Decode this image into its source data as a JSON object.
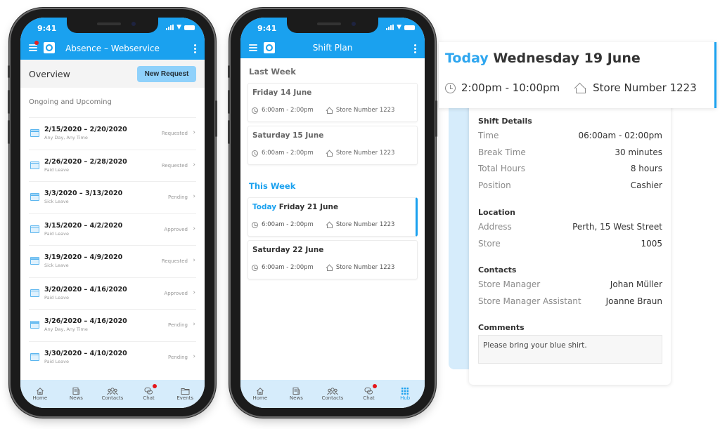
{
  "phone1": {
    "status_time": "9:41",
    "app_title": "Absence – Webservice",
    "overview_title": "Overview",
    "new_request_label": "New Request",
    "section_title": "Ongoing and Upcoming",
    "absences": [
      {
        "dates": "2/15/2020 – 2/20/2020",
        "type": "Any Day, Any Time",
        "status": "Requested"
      },
      {
        "dates": "2/26/2020 – 2/28/2020",
        "type": "Paid Leave",
        "status": "Requested"
      },
      {
        "dates": "3/3/2020 – 3/13/2020",
        "type": "Sick Leave",
        "status": "Pending"
      },
      {
        "dates": "3/15/2020 – 4/2/2020",
        "type": "Paid Leave",
        "status": "Approved"
      },
      {
        "dates": "3/19/2020 – 4/9/2020",
        "type": "Sick Leave",
        "status": "Requested"
      },
      {
        "dates": "3/20/2020 – 4/16/2020",
        "type": "Paid Leave",
        "status": "Approved"
      },
      {
        "dates": "3/26/2020 – 4/16/2020",
        "type": "Any Day, Any Time",
        "status": "Pending"
      },
      {
        "dates": "3/30/2020 – 4/10/2020",
        "type": "Paid Leave",
        "status": "Pending"
      }
    ],
    "tabs": [
      {
        "label": "Home",
        "icon": "home-icon"
      },
      {
        "label": "News",
        "icon": "news-icon"
      },
      {
        "label": "Contacts",
        "icon": "contacts-icon"
      },
      {
        "label": "Chat",
        "icon": "chat-icon",
        "badge": true
      },
      {
        "label": "Events",
        "icon": "folder-icon"
      }
    ]
  },
  "phone2": {
    "status_time": "9:41",
    "app_title": "Shift Plan",
    "last_week_title": "Last Week",
    "this_week_title": "This Week",
    "last_week": [
      {
        "title": "Friday 14 June",
        "time": "6:00am - 2:00pm",
        "store": "Store Number 1223"
      },
      {
        "title": "Saturday 15 June",
        "time": "6:00am - 2:00pm",
        "store": "Store Number 1223"
      }
    ],
    "this_week": [
      {
        "today_label": "Today",
        "title": "Friday 21 June",
        "time": "6:00am - 2:00pm",
        "store": "Store Number 1223",
        "active": true
      },
      {
        "title": "Saturday 22 June",
        "time": "6:00am - 2:00pm",
        "store": "Store Number 1223"
      }
    ],
    "tabs": [
      {
        "label": "Home",
        "icon": "home-icon"
      },
      {
        "label": "News",
        "icon": "news-icon"
      },
      {
        "label": "Contacts",
        "icon": "contacts-icon"
      },
      {
        "label": "Chat",
        "icon": "chat-icon",
        "badge": true
      },
      {
        "label": "Hub",
        "icon": "grid-icon",
        "active": true
      }
    ]
  },
  "detail": {
    "today_label": "Today",
    "title": "Wednesday 19 June",
    "time": "2:00pm - 10:00pm",
    "store": "Store Number 1223",
    "shift_details": {
      "heading": "Shift Details",
      "rows": [
        {
          "label": "Time",
          "value": "06:00am - 02:00pm"
        },
        {
          "label": "Break Time",
          "value": "30 minutes"
        },
        {
          "label": "Total Hours",
          "value": "8 hours"
        },
        {
          "label": "Position",
          "value": "Cashier"
        }
      ]
    },
    "location": {
      "heading": "Location",
      "rows": [
        {
          "label": "Address",
          "value": "Perth, 15 West Street"
        },
        {
          "label": "Store",
          "value": "1005"
        }
      ]
    },
    "contacts": {
      "heading": "Contacts",
      "rows": [
        {
          "label": "Store Manager",
          "value": "Johan Müller"
        },
        {
          "label": "Store Manager Assistant",
          "value": "Joanne Braun"
        }
      ]
    },
    "comments": {
      "heading": "Comments",
      "text": "Please bring your blue shirt."
    }
  },
  "colors": {
    "brand_blue": "#1aa1ef",
    "light_blue": "#d6ecfb",
    "button_blue": "#8fd1fb",
    "badge_red": "#e5141a"
  }
}
